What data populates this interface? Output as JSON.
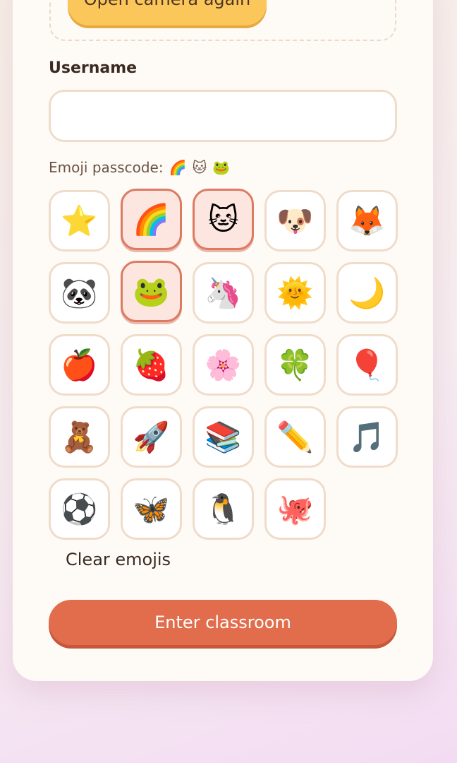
{
  "camera": {
    "button_label": "Open camera again"
  },
  "username": {
    "label": "Username",
    "value": "",
    "placeholder": ""
  },
  "passcode": {
    "label": "Emoji passcode:",
    "selected": [
      "🌈",
      "🐱",
      "🐸"
    ]
  },
  "emoji_grid": [
    {
      "emoji": "⭐",
      "name": "star",
      "selected": false
    },
    {
      "emoji": "🌈",
      "name": "rainbow",
      "selected": true
    },
    {
      "emoji": "🐱",
      "name": "cat",
      "selected": true
    },
    {
      "emoji": "🐶",
      "name": "dog",
      "selected": false
    },
    {
      "emoji": "🦊",
      "name": "fox",
      "selected": false
    },
    {
      "emoji": "🐼",
      "name": "panda",
      "selected": false
    },
    {
      "emoji": "🐸",
      "name": "frog",
      "selected": true
    },
    {
      "emoji": "🦄",
      "name": "unicorn",
      "selected": false
    },
    {
      "emoji": "🌞",
      "name": "sun",
      "selected": false
    },
    {
      "emoji": "🌙",
      "name": "moon",
      "selected": false
    },
    {
      "emoji": "🍎",
      "name": "apple",
      "selected": false
    },
    {
      "emoji": "🍓",
      "name": "strawberry",
      "selected": false
    },
    {
      "emoji": "🌸",
      "name": "flower",
      "selected": false
    },
    {
      "emoji": "🍀",
      "name": "clover",
      "selected": false
    },
    {
      "emoji": "🎈",
      "name": "balloon",
      "selected": false
    },
    {
      "emoji": "🧸",
      "name": "teddy-bear",
      "selected": false
    },
    {
      "emoji": "🚀",
      "name": "rocket",
      "selected": false
    },
    {
      "emoji": "📚",
      "name": "books",
      "selected": false
    },
    {
      "emoji": "✏️",
      "name": "pencil",
      "selected": false
    },
    {
      "emoji": "🎵",
      "name": "music-note",
      "selected": false
    },
    {
      "emoji": "⚽",
      "name": "soccer-ball",
      "selected": false
    },
    {
      "emoji": "🦋",
      "name": "butterfly",
      "selected": false
    },
    {
      "emoji": "🐧",
      "name": "penguin",
      "selected": false
    },
    {
      "emoji": "🐙",
      "name": "octopus",
      "selected": false
    }
  ],
  "clear_label": "Clear emojis",
  "enter_label": "Enter classroom",
  "colors": {
    "accent": "#e26d4d",
    "camera_button": "#fcc75a",
    "selected_tile_border": "#dd7a62",
    "selected_tile_bg": "#fde6df"
  }
}
